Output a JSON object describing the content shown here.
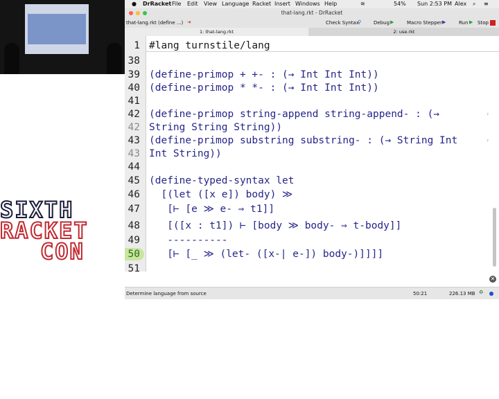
{
  "logo": {
    "line1": "SIXTH",
    "line2": "RACKET",
    "line3": "CON"
  },
  "menubar": {
    "app": "DrRacket",
    "items": [
      "File",
      "Edit",
      "View",
      "Language",
      "Racket",
      "Insert",
      "Windows",
      "Help"
    ],
    "battery": "54%",
    "clock": "Sun 2:53 PM",
    "user": "Alex"
  },
  "window": {
    "title": "that-lang.rkt - DrRacket"
  },
  "toolbar": {
    "file_menu": "that-lang.rkt",
    "define_menu": "(define ...)",
    "check_syntax": "Check Syntax",
    "debug": "Debug",
    "macro_stepper": "Macro Stepper",
    "run": "Run",
    "stop": "Stop"
  },
  "tabs": [
    {
      "label": "1: that-lang.rkt"
    },
    {
      "label": "2: use.rkt"
    }
  ],
  "editor": {
    "lines": [
      {
        "num": "1",
        "text": "#lang turnstile/lang"
      },
      {
        "num": "38",
        "text": ""
      },
      {
        "num": "39",
        "text": "(define-primop + +- : (→ Int Int Int))"
      },
      {
        "num": "40",
        "text": "(define-primop * *- : (→ Int Int Int))"
      },
      {
        "num": "41",
        "text": ""
      },
      {
        "num": "42",
        "text": "(define-primop string-append string-append- : (→"
      },
      {
        "num": "42",
        "text": "String String String))"
      },
      {
        "num": "43",
        "text": "(define-primop substring substring- : (→ String Int"
      },
      {
        "num": "43",
        "text": "Int String))"
      },
      {
        "num": "44",
        "text": ""
      },
      {
        "num": "45",
        "text": "(define-typed-syntax let"
      },
      {
        "num": "46",
        "text": "  [(let ([x e]) body) ≫"
      },
      {
        "num": "47",
        "text": "   [⊢ [e ≫ e- ⇒ t1]]"
      },
      {
        "num": "48",
        "text": "   [([x : t1]) ⊢ [body ≫ body- ⇒ t-body]]"
      },
      {
        "num": "49",
        "text": "   ----------"
      },
      {
        "num": "50",
        "text": "   [⊢ [_ ≫ (let- ([x-| e-]) body-)]]]]"
      },
      {
        "num": "51",
        "text": ""
      }
    ]
  },
  "status": {
    "language": "Determine language from source",
    "position": "50:21",
    "memory": "226.13 MB"
  },
  "colors": {
    "paren": "#7f2a26",
    "keyword": "#25258a",
    "highlight": "#c8e6a0"
  }
}
